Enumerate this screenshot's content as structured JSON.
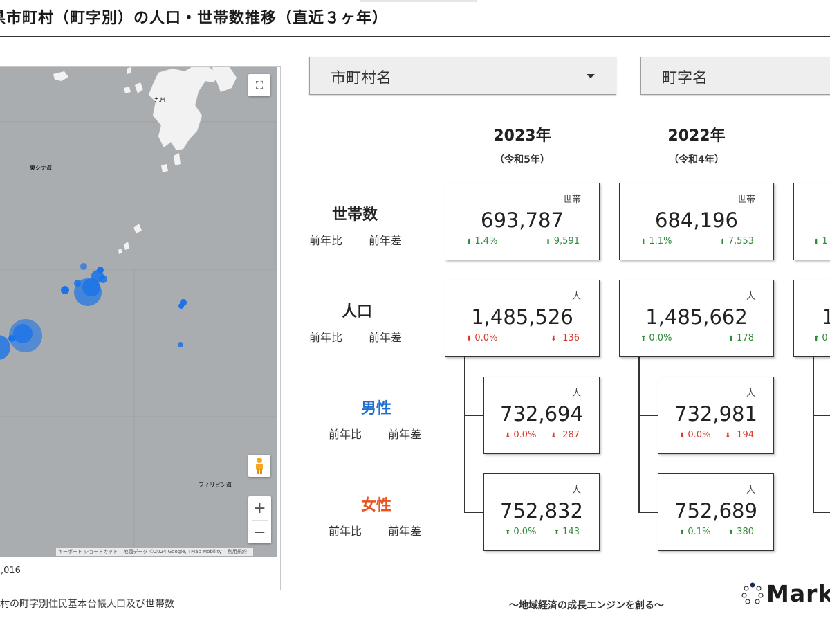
{
  "page": {
    "title": "県市町村（町字別）の人口・世帯数推移（直近３ヶ年）"
  },
  "map": {
    "sea_labels": {
      "east_china_sea": "東シナ海",
      "philippine_sea": "フィリピン海",
      "kyushu": "九州"
    },
    "attribution": [
      "キーボード ショートカット",
      "地図データ ©2024 Google, TMap Mobility",
      "利用規約"
    ],
    "legend_value": ",016",
    "icons": {
      "fullscreen": "fullscreen-icon",
      "pegman": "pegman-icon",
      "zoom_in": "plus-icon",
      "zoom_out": "minus-icon"
    },
    "marker_color": "#1a73e8"
  },
  "source_note": "村の町字別住民基本台帳人口及び世帯数",
  "filters": {
    "municipality": {
      "label": "市町村名"
    },
    "town": {
      "label": "町字名"
    }
  },
  "years": [
    {
      "year": "2023年",
      "era": "（令和5年）"
    },
    {
      "year": "2022年",
      "era": "（令和4年）"
    }
  ],
  "rows": {
    "households": {
      "label": "世帯数",
      "ratio_label": "前年比",
      "diff_label": "前年差"
    },
    "population": {
      "label": "人口",
      "ratio_label": "前年比",
      "diff_label": "前年差"
    },
    "male": {
      "label": "男性",
      "ratio_label": "前年比",
      "diff_label": "前年差"
    },
    "female": {
      "label": "女性",
      "ratio_label": "前年比",
      "diff_label": "前年差"
    }
  },
  "cards": {
    "households_2023": {
      "unit": "世帯",
      "value": "693,787",
      "ratio": "1.4%",
      "diff": "9,591",
      "ratio_dir": "up",
      "diff_dir": "up"
    },
    "households_2022": {
      "unit": "世帯",
      "value": "684,196",
      "ratio": "1.1%",
      "diff": "7,553",
      "ratio_dir": "up",
      "diff_dir": "up"
    },
    "households_2021": {
      "ratio": "1"
    },
    "population_2023": {
      "unit": "人",
      "value": "1,485,526",
      "ratio": "0.0%",
      "diff": "-136",
      "ratio_dir": "down",
      "diff_dir": "down"
    },
    "population_2022": {
      "unit": "人",
      "value": "1,485,662",
      "ratio": "0.0%",
      "diff": "178",
      "ratio_dir": "up",
      "diff_dir": "up"
    },
    "population_2021": {
      "value": "1",
      "ratio": "0"
    },
    "male_2023": {
      "unit": "人",
      "value": "732,694",
      "ratio": "0.0%",
      "diff": "-287",
      "ratio_dir": "down",
      "diff_dir": "down"
    },
    "male_2022": {
      "unit": "人",
      "value": "732,981",
      "ratio": "0.0%",
      "diff": "-194",
      "ratio_dir": "down",
      "diff_dir": "down"
    },
    "female_2023": {
      "unit": "人",
      "value": "752,832",
      "ratio": "0.0%",
      "diff": "143",
      "ratio_dir": "up",
      "diff_dir": "up"
    },
    "female_2022": {
      "unit": "人",
      "value": "752,689",
      "ratio": "0.1%",
      "diff": "380",
      "ratio_dir": "up",
      "diff_dir": "up"
    }
  },
  "footer": {
    "tagline": "〜地域経済の成長エンジンを創る〜",
    "logo": "Mark"
  },
  "colors": {
    "up": "#2e8b3a",
    "down": "#d93a2b",
    "male": "#1f6fd1",
    "female": "#e8541f"
  }
}
